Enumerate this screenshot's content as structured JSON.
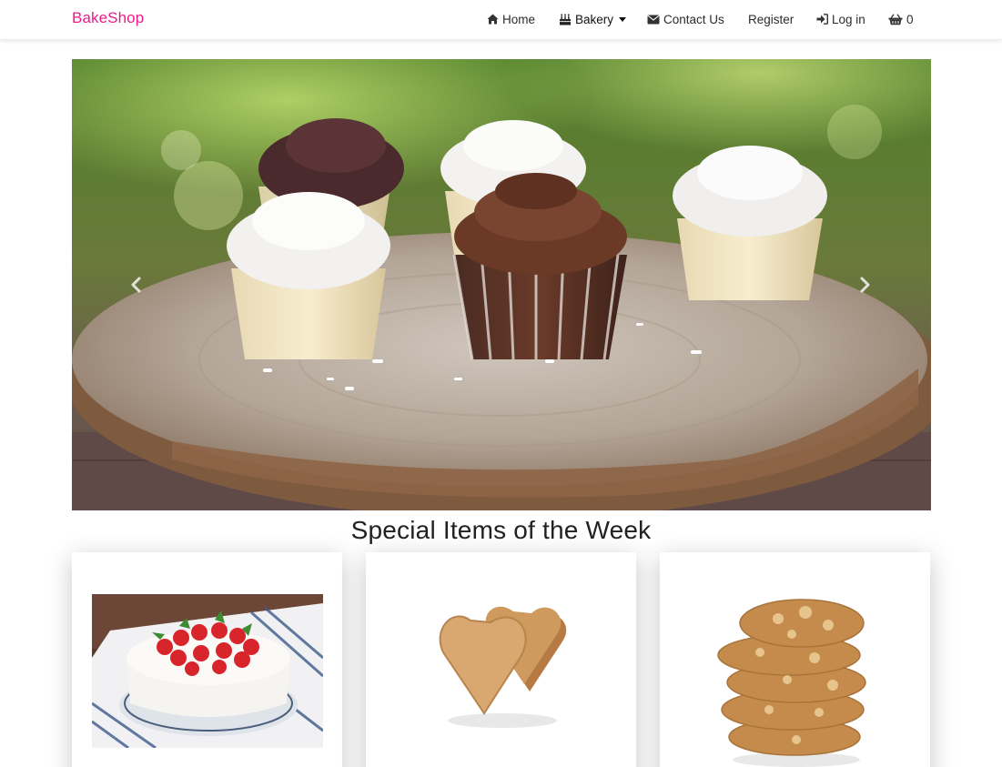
{
  "brand": {
    "name": "BakeShop",
    "color": "#e91e8c"
  },
  "nav": {
    "home": {
      "icon": "home-icon",
      "label": "Home"
    },
    "bakery": {
      "icon": "birthday-cake-icon",
      "label": "Bakery"
    },
    "contact": {
      "icon": "envelope-icon",
      "label": "Contact Us"
    },
    "register": {
      "label": "Register"
    },
    "login": {
      "icon": "sign-in-icon",
      "label": "Log in"
    },
    "cart": {
      "icon": "shopping-basket-icon",
      "count": "0"
    }
  },
  "carousel": {
    "prev_icon": "chevron-left-icon",
    "next_icon": "chevron-right-icon"
  },
  "section": {
    "title": "Special Items of the Week"
  },
  "cards": [
    {
      "image": "strawberry-cake"
    },
    {
      "image": "heart-cookies"
    },
    {
      "image": "stacked-cookies"
    }
  ]
}
